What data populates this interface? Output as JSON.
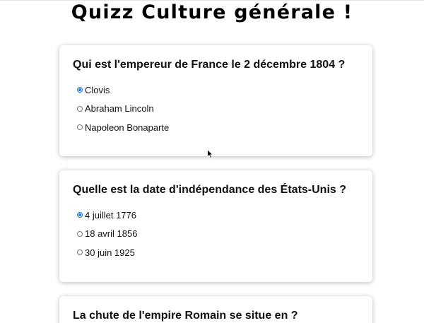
{
  "page": {
    "title": "Quizz Culture générale !"
  },
  "questions": [
    {
      "text": "Qui est l'empereur de France le 2 décembre 1804 ?",
      "options": [
        "Clovis",
        "Abraham Lincoln",
        "Napoleon Bonaparte"
      ],
      "selected": "Clovis"
    },
    {
      "text": "Quelle est la date d'indépendance des États-Unis ?",
      "options": [
        "4 juillet 1776",
        "18 avril 1856",
        "30 juin 1925"
      ],
      "selected": "4 juillet 1776"
    },
    {
      "text": "La chute de l'empire Romain se situe en ?",
      "options": [],
      "selected": null
    }
  ],
  "colors": {
    "radio_checked": "#1a73e8",
    "radio_unchecked": "#767676"
  },
  "icons": {
    "cursor": "mouse-pointer-icon"
  }
}
